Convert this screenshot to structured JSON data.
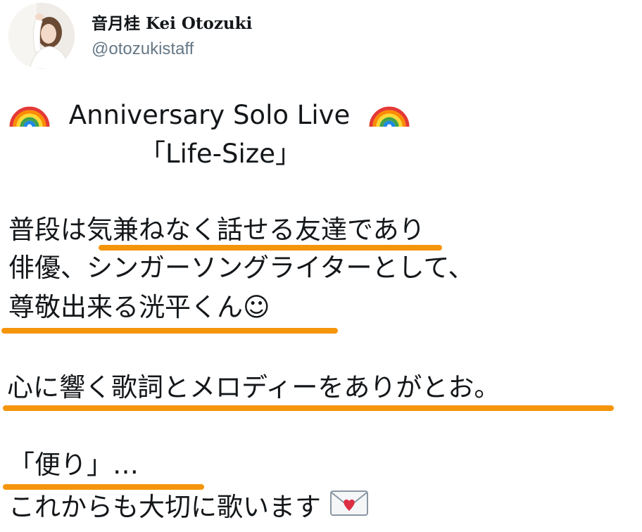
{
  "author": {
    "display_name": "音月桂 Kei Otozuki",
    "handle": "@otozukistaff",
    "avatar_icon": "profile-photo"
  },
  "post": {
    "line_1_text": "Anniversary Solo Live",
    "line_1_emoji": "rainbow-emoji",
    "line_2": "「Life-Size」",
    "line_3": "普段は気兼ねなく話せる友達であり",
    "line_4": "俳優、シンガーソングライターとして、",
    "line_5": "尊敬出来る洸平くん☺",
    "line_6": "心に響く歌詞とメロディーをありがとお。",
    "line_7": "「便り」…",
    "line_8": "これからも大切に歌います",
    "line_8_emoji": "love-letter-emoji"
  },
  "highlight_color": "#f5950c"
}
